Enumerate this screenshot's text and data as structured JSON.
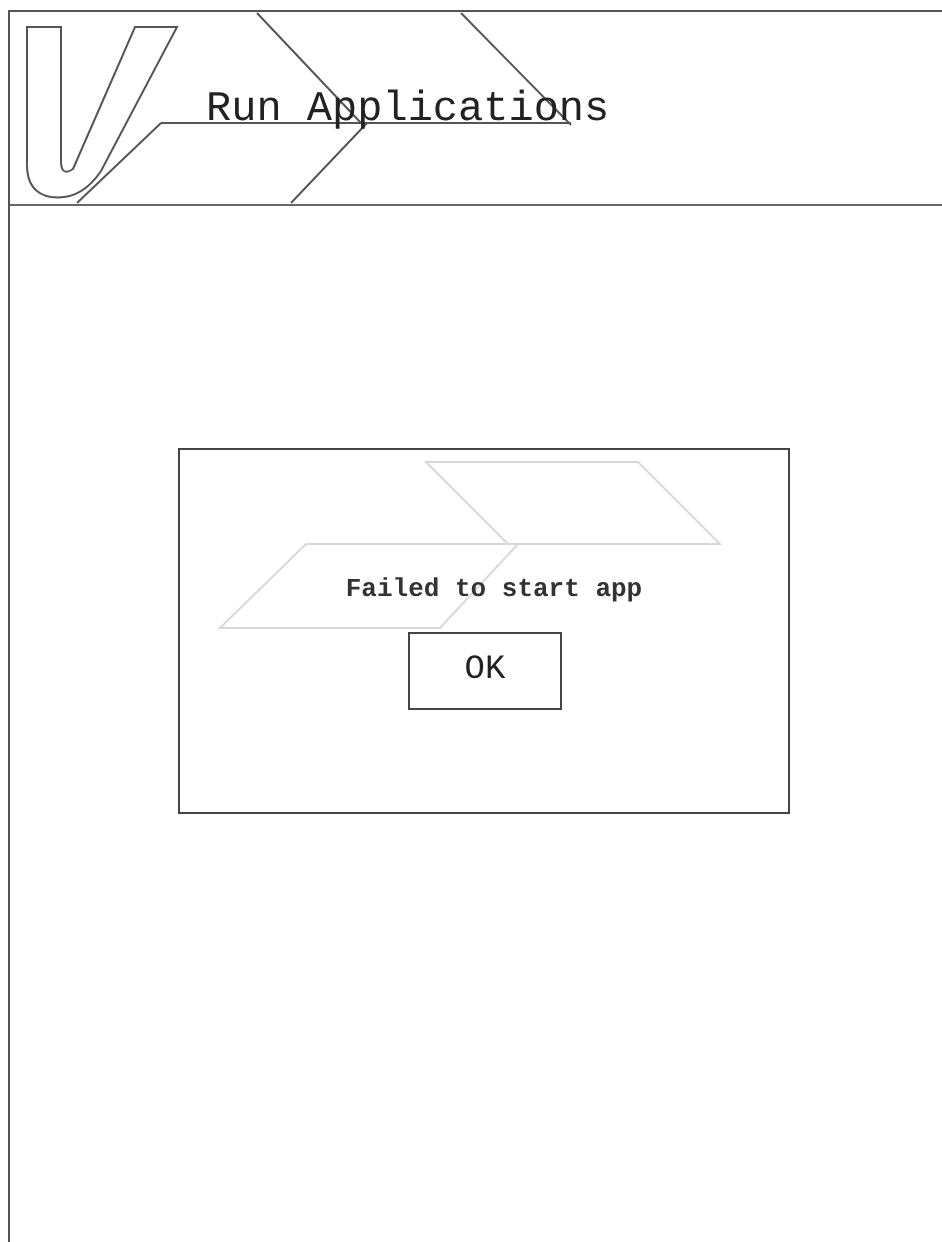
{
  "header": {
    "title": "Run Applications"
  },
  "dialog": {
    "message": "Failed to start app",
    "buttons": [
      "OK"
    ]
  }
}
